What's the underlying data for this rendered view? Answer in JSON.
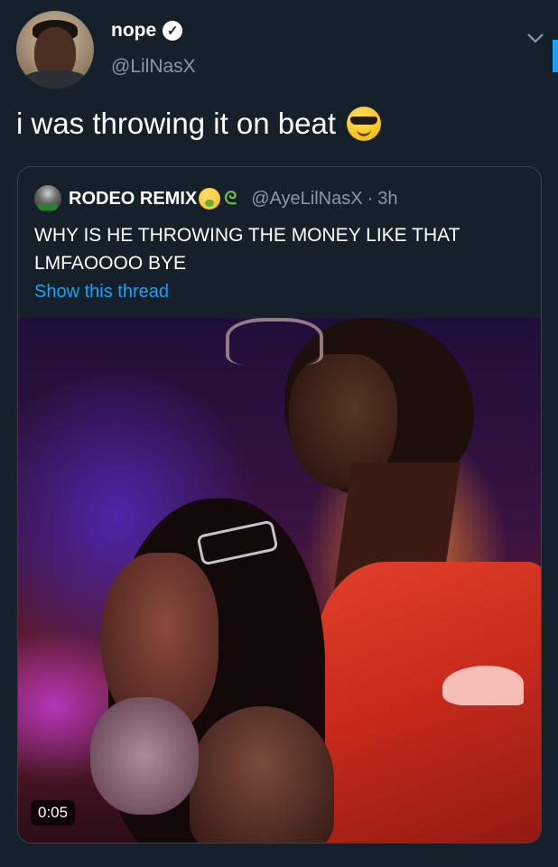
{
  "tweet": {
    "display_name": "nope",
    "verified_icon": "verified-badge-icon",
    "handle": "@LilNasX",
    "text": "i was throwing it on beat",
    "emoji": "smiling-face-with-sunglasses"
  },
  "quoted": {
    "display_name": "RODEO REMIX",
    "emojis": [
      "nauseated-face",
      "snake"
    ],
    "handle": "@AyeLilNasX",
    "separator": "·",
    "time": "3h",
    "text_lines": [
      "WHY IS HE THROWING THE MONEY LIKE THAT",
      "LMFAOOOO BYE"
    ],
    "show_thread": "Show this thread",
    "video": {
      "duration": "0:05"
    }
  },
  "colors": {
    "background": "#15202b",
    "link": "#1da1f2",
    "secondary_text": "#8899a6",
    "border": "#38444d"
  }
}
